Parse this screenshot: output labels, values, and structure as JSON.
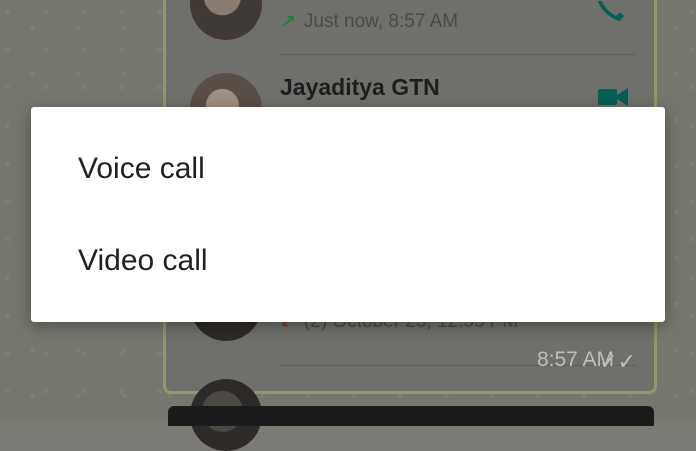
{
  "call_log": {
    "entries": [
      {
        "name": "",
        "status_text": "Just now, 8:57 AM",
        "direction": "outgoing",
        "call_type": "voice"
      },
      {
        "name": "Jayaditya GTN",
        "status_text": "",
        "direction": "",
        "call_type": "video"
      },
      {
        "name": "",
        "status_text": "(2) October 23, 12:55 PM",
        "direction": "incoming-missed",
        "call_type": ""
      }
    ],
    "message_time": "8:57 AM",
    "ticks": "✓✓"
  },
  "dialog": {
    "options": [
      "Voice call",
      "Video call"
    ]
  },
  "colors": {
    "outgoing_arrow": "#1a7f3c",
    "missed_arrow": "#a33025",
    "accent_green": "#075e54"
  },
  "icons": {
    "outgoing": "↗",
    "missed": "↙"
  }
}
